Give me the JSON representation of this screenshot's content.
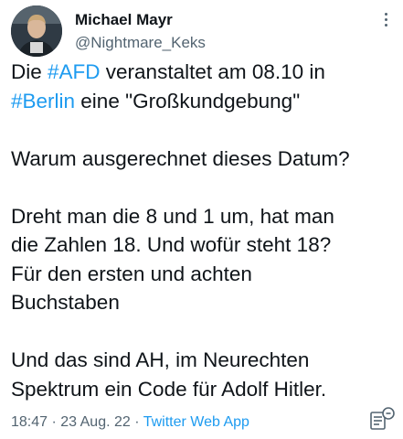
{
  "author": {
    "name": "Michael Mayr",
    "handle": "@Nightmare_Keks"
  },
  "tweet": {
    "line1": {
      "pre": "Die ",
      "tag": "#AFD",
      "post": " veranstaltet am 08.10 in"
    },
    "line2": {
      "tag": "#Berlin",
      "post": " eine \"Großkundgebung\""
    },
    "para2": "Warum ausgerechnet dieses Datum?",
    "para3": [
      "Dreht man die 8 und 1 um, hat man",
      "die Zahlen 18. Und wofür steht 18?",
      "Für den ersten und achten",
      "Buchstaben"
    ],
    "para4": [
      "Und das sind AH, im Neurechten",
      "Spektrum ein Code für Adolf Hitler."
    ]
  },
  "meta": {
    "time": "18:47",
    "sep1": " · ",
    "date": "23 Aug. 22",
    "sep2": " · ",
    "source": "Twitter Web App"
  },
  "colors": {
    "link": "#1d9bf0",
    "text": "#0f1419",
    "secondary": "#536471"
  },
  "icons": {
    "more": "more-vertical-icon",
    "translate": "translate-icon"
  }
}
